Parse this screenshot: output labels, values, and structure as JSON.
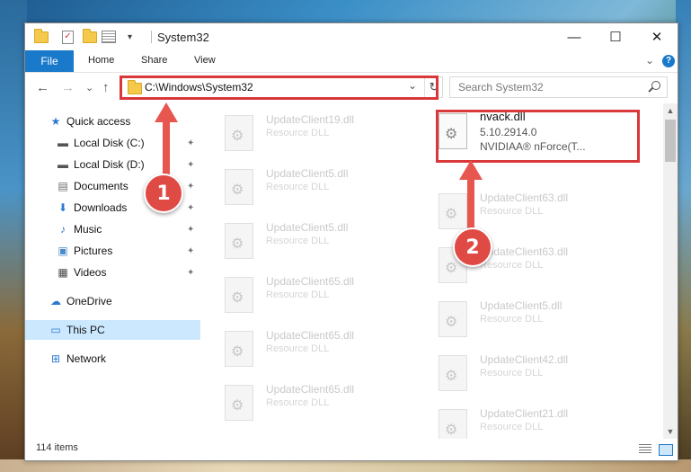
{
  "window": {
    "title": "System32",
    "quick_access_dropdown": "▾",
    "minimize_glyph": "—",
    "maximize_glyph": "☐",
    "close_glyph": "✕"
  },
  "ribbon": {
    "file_tab": "File",
    "tabs": [
      "Home",
      "Share",
      "View"
    ],
    "expand_glyph": "⌄",
    "help_glyph": "?"
  },
  "nav": {
    "back_glyph": "←",
    "forward_glyph": "→",
    "recent_glyph": "⌄",
    "up_glyph": "↑",
    "address": "C:\\Windows\\System32",
    "address_dropdown_glyph": "⌄",
    "refresh_glyph": "↻",
    "search_placeholder": "Search System32"
  },
  "sidebar": {
    "items": [
      {
        "label": "Quick access",
        "icon": "star-icon",
        "glyph": "★",
        "color": "#2b79d0",
        "pinned": false
      },
      {
        "label": "Local Disk (C:)",
        "icon": "drive-icon",
        "glyph": "▬",
        "color": "#555555",
        "pinned": true
      },
      {
        "label": "Local Disk (D:)",
        "icon": "drive-icon",
        "glyph": "▬",
        "color": "#555555",
        "pinned": true
      },
      {
        "label": "Documents",
        "icon": "document-icon",
        "glyph": "▤",
        "color": "#6a6a6a",
        "pinned": true
      },
      {
        "label": "Downloads",
        "icon": "download-icon",
        "glyph": "⬇",
        "color": "#2b79d0",
        "pinned": true
      },
      {
        "label": "Music",
        "icon": "music-icon",
        "glyph": "♪",
        "color": "#2b79d0",
        "pinned": true
      },
      {
        "label": "Pictures",
        "icon": "pictures-icon",
        "glyph": "▣",
        "color": "#4a8ac8",
        "pinned": true
      },
      {
        "label": "Videos",
        "icon": "videos-icon",
        "glyph": "▦",
        "color": "#444444",
        "pinned": true
      },
      {
        "label": "OneDrive",
        "icon": "cloud-icon",
        "glyph": "☁",
        "color": "#2b79d0",
        "pinned": false
      },
      {
        "label": "This PC",
        "icon": "computer-icon",
        "glyph": "▭",
        "color": "#2b79d0",
        "pinned": false
      },
      {
        "label": "Network",
        "icon": "network-icon",
        "glyph": "⊞",
        "color": "#2b79d0",
        "pinned": false
      }
    ],
    "pin_glyph": "✦"
  },
  "files": {
    "left_column": [
      {
        "name": "UpdateClient19.dll",
        "type": "Resource DLL"
      },
      {
        "name": "UpdateClient5.dll",
        "type": "Resource DLL"
      },
      {
        "name": "UpdateClient5.dll",
        "type": "Resource DLL"
      },
      {
        "name": "UpdateClient65.dll",
        "type": "Resource DLL"
      },
      {
        "name": "UpdateClient65.dll",
        "type": "Resource DLL"
      },
      {
        "name": "UpdateClient65.dll",
        "type": "Resource DLL"
      }
    ],
    "right_column": [
      {
        "name": "UpdateClient63.dll",
        "type": "Resource DLL"
      },
      {
        "name": "UpdateClient63.dll",
        "type": "Resource DLL"
      },
      {
        "name": "UpdateClient5.dll",
        "type": "Resource DLL"
      },
      {
        "name": "UpdateClient42.dll",
        "type": "Resource DLL"
      },
      {
        "name": "UpdateClient21.dll",
        "type": "Resource DLL"
      }
    ],
    "highlighted": {
      "name": "nvack.dll",
      "version": "5.10.2914.0",
      "description": "NVIDIAA® nForce(T..."
    }
  },
  "scrollbar": {
    "up_glyph": "▲",
    "down_glyph": "▼"
  },
  "status": {
    "item_count": "114 items"
  },
  "annotations": {
    "badge_1": "1",
    "badge_2": "2"
  },
  "colors": {
    "accent": "#1979ca",
    "highlight": "#d9383a",
    "badge": "#e04a45",
    "selected": "#cce8ff"
  }
}
